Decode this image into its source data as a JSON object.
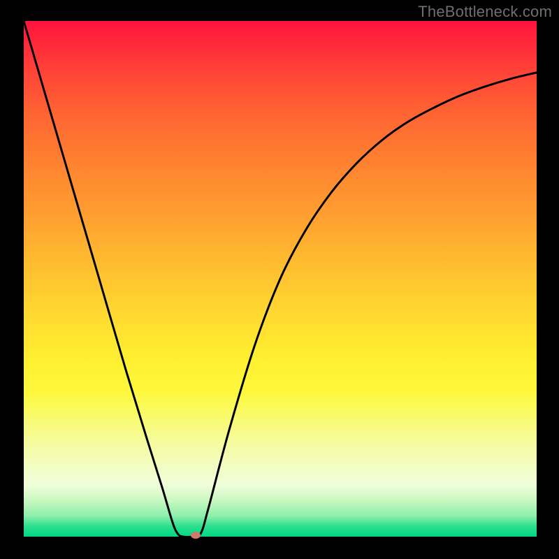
{
  "watermark": "TheBottleneck.com",
  "chart_data": {
    "type": "line",
    "title": "",
    "xlabel": "",
    "ylabel": "",
    "xlim": [
      0,
      1
    ],
    "ylim": [
      0,
      1
    ],
    "curve_points": [
      {
        "x": 0.0,
        "y": 1.0
      },
      {
        "x": 0.05,
        "y": 0.83
      },
      {
        "x": 0.1,
        "y": 0.66
      },
      {
        "x": 0.15,
        "y": 0.49
      },
      {
        "x": 0.2,
        "y": 0.32
      },
      {
        "x": 0.24,
        "y": 0.19
      },
      {
        "x": 0.27,
        "y": 0.095
      },
      {
        "x": 0.29,
        "y": 0.028
      },
      {
        "x": 0.3,
        "y": 0.006
      },
      {
        "x": 0.31,
        "y": 0.0
      },
      {
        "x": 0.33,
        "y": 0.0
      },
      {
        "x": 0.345,
        "y": 0.006
      },
      {
        "x": 0.36,
        "y": 0.055
      },
      {
        "x": 0.4,
        "y": 0.205
      },
      {
        "x": 0.45,
        "y": 0.37
      },
      {
        "x": 0.5,
        "y": 0.5
      },
      {
        "x": 0.55,
        "y": 0.595
      },
      {
        "x": 0.6,
        "y": 0.668
      },
      {
        "x": 0.65,
        "y": 0.725
      },
      {
        "x": 0.7,
        "y": 0.77
      },
      {
        "x": 0.75,
        "y": 0.805
      },
      {
        "x": 0.8,
        "y": 0.832
      },
      {
        "x": 0.85,
        "y": 0.855
      },
      {
        "x": 0.9,
        "y": 0.873
      },
      {
        "x": 0.95,
        "y": 0.888
      },
      {
        "x": 1.0,
        "y": 0.9
      }
    ],
    "marker": {
      "x": 0.335,
      "y": 0.003,
      "color": "#d07a6e"
    },
    "gradient_colors": {
      "top": "#ff143d",
      "mid": "#ffdc30",
      "bottom": "#00d884"
    }
  }
}
